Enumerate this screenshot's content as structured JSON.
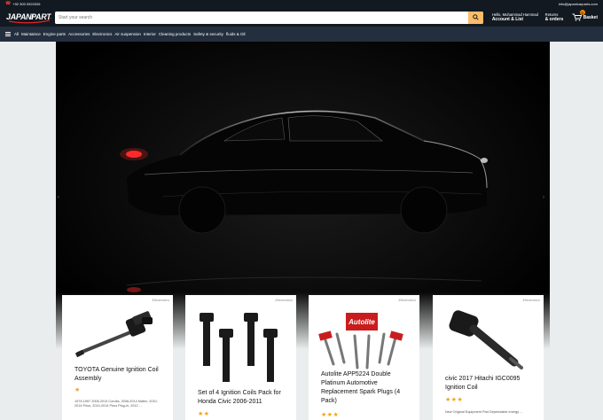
{
  "topbar": {
    "phone": "+92 300 0922026",
    "email": "info@japanicarparts.com"
  },
  "header": {
    "logo_text": "JAPANI PARTS",
    "search_placeholder": "Start your search",
    "account_greeting": "Hello, Muhammad Hammad",
    "account_label": "Account & List",
    "returns_top": "Returns",
    "returns_bottom": "& orders",
    "basket_label": "Basket",
    "basket_count": "0"
  },
  "nav": {
    "items": [
      "All",
      "Maintaince",
      "Engine parts",
      "Accessories",
      "Electronics",
      "Air suspension",
      "Interior",
      "Cleaning products",
      "Safety & security",
      "fluids & Oil"
    ]
  },
  "products": [
    {
      "category": "Electronics",
      "title": "TOYOTA Genuine Ignition Coil Assembly",
      "stars": "★",
      "description": "1975-1997 2008-2014 Corolla, 2008-2014 Matrix, 2010-2014 Prius, 2010-2014 Prius Plug-in, 2012 ..."
    },
    {
      "category": "Electronics",
      "title": "Set of 4 Ignition Coils Pack for Honda Civic 2006-2011",
      "stars": "★★"
    },
    {
      "category": "Electronics",
      "title": "Autolite APP5224 Double Platinum Automotive Replacement Spark Plugs (4 Pack)",
      "stars": "★★★",
      "brand_text": "Autolite"
    },
    {
      "category": "Electronics",
      "title": "civic 2017 Hitachi IGC0095 Ignition Coil",
      "stars": "★★★",
      "description": "New Original Equipment Part Dependable energy ..."
    }
  ],
  "colors": {
    "header_bg": "#131921",
    "nav_bg": "#232f3e",
    "search_btn": "#febd69",
    "star": "#f1a417",
    "tail_light": "#ff2a2a"
  }
}
